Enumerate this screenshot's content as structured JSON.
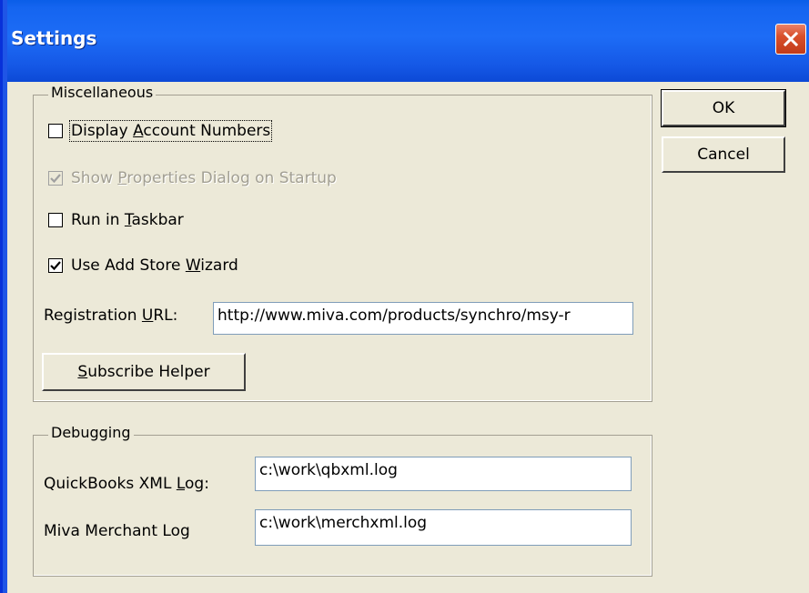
{
  "window": {
    "title": "Settings"
  },
  "miscellaneous": {
    "label": "Miscellaneous",
    "display_account_numbers": {
      "pre": "Display ",
      "key": "A",
      "post": "ccount Numbers",
      "checked": false
    },
    "show_properties_dialog": {
      "pre": "Show ",
      "key": "P",
      "post": "roperties Dialog on Startup",
      "checked": true,
      "disabled": true
    },
    "run_in_taskbar": {
      "pre": "Run in ",
      "key": "T",
      "post": "askbar",
      "checked": false
    },
    "use_add_store_wizard": {
      "pre": "Use Add Store ",
      "key": "W",
      "post": "izard",
      "checked": true
    },
    "registration_url": {
      "pre": "Registration ",
      "key": "U",
      "post": "RL:",
      "value": "http://www.miva.com/products/synchro/msy-r"
    },
    "subscribe_helper": {
      "key": "S",
      "post": "ubscribe Helper"
    }
  },
  "debugging": {
    "label": "Debugging",
    "quickbooks_log": {
      "pre": "QuickBooks XML ",
      "key": "L",
      "post": "og:",
      "value": "c:\\work\\qbxml.log"
    },
    "miva_log": {
      "label": "Miva Merchant Log",
      "value": "c:\\work\\merchxml.log"
    }
  },
  "buttons": {
    "ok": "OK",
    "cancel": "Cancel"
  }
}
